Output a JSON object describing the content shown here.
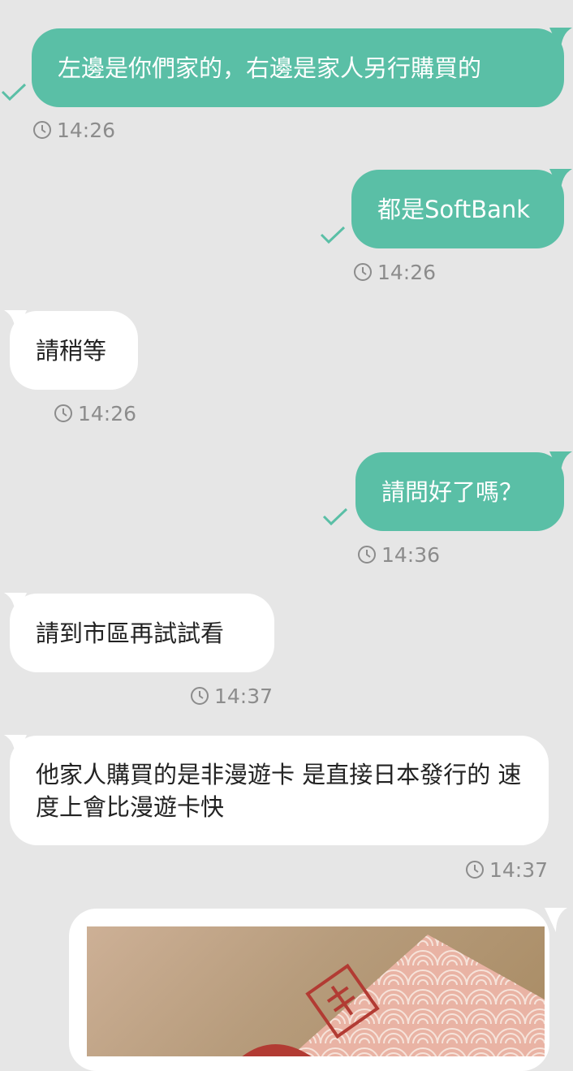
{
  "messages": [
    {
      "side": "out",
      "text": "左邊是你們家的，右邊是家人另行購買的",
      "time": "14:26",
      "read": true
    },
    {
      "side": "out",
      "text": "都是SoftBank",
      "time": "14:26",
      "read": true
    },
    {
      "side": "in",
      "text": "請稍等",
      "time": "14:26"
    },
    {
      "side": "out",
      "text": "請問好了嗎？",
      "time": "14:36",
      "read": true
    },
    {
      "side": "in",
      "text": "請到市區再試試看",
      "time": "14:37"
    },
    {
      "side": "in",
      "text": "他家人購買的是非漫遊卡 是直接日本發行的 速度上會比漫遊卡快",
      "time": "14:37"
    }
  ],
  "image_message": {
    "kind": "photo",
    "subject": "SIM card package"
  },
  "colors": {
    "background": "#e6e6e6",
    "outgoing_bubble": "#5abfa6",
    "incoming_bubble": "#ffffff",
    "timestamp": "#8c8c8c"
  },
  "icons": {
    "time": "clock-icon",
    "read": "check-icon"
  }
}
